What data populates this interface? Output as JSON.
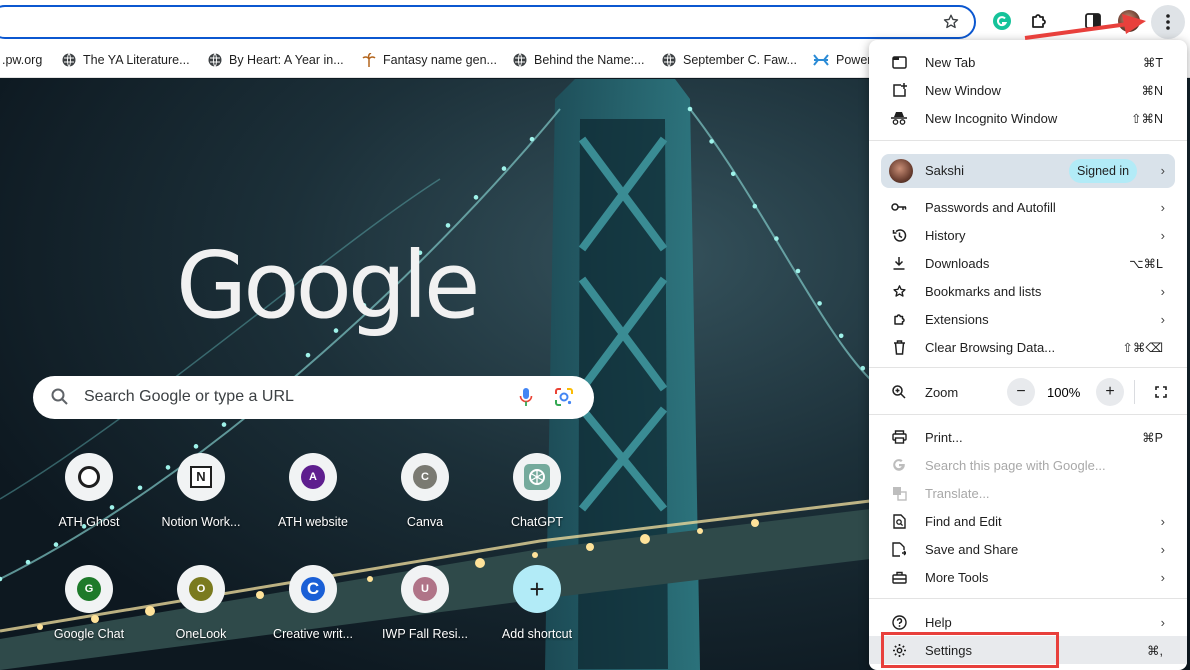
{
  "toolbar": {
    "star_icon": "star-icon",
    "icons": [
      "grammarly-icon",
      "extensions-puzzle-icon",
      "side-panel-icon",
      "profile-avatar-icon",
      "kebab-menu-icon"
    ]
  },
  "bookmarks": [
    {
      "label": ".pw.org",
      "icon": "none"
    },
    {
      "label": "The YA Literature...",
      "icon": "globe-icon"
    },
    {
      "label": "By Heart: A Year in...",
      "icon": "globe-icon"
    },
    {
      "label": "Fantasy name gen...",
      "icon": "palm-icon"
    },
    {
      "label": "Behind the Name:...",
      "icon": "globe-icon"
    },
    {
      "label": "September C. Faw...",
      "icon": "globe-icon"
    },
    {
      "label": "Power",
      "icon": "power-icon"
    }
  ],
  "ntp": {
    "logo": "Google",
    "search_placeholder": "Search Google or type a URL",
    "shortcuts": [
      {
        "label": "ATH Ghost",
        "letter": "",
        "color": "#1f1f1f"
      },
      {
        "label": "Notion Work...",
        "letter": "N",
        "color": "#1f1f1f"
      },
      {
        "label": "ATH website",
        "letter": "A",
        "color": "#5e1e8e"
      },
      {
        "label": "Canva",
        "letter": "C",
        "color": "#7a7a72"
      },
      {
        "label": "ChatGPT",
        "letter": "",
        "color": "#74aa9c"
      },
      {
        "label": "Google Chat",
        "letter": "G",
        "color": "#1e7a2a"
      },
      {
        "label": "OneLook",
        "letter": "O",
        "color": "#7a7a1e"
      },
      {
        "label": "Creative writ...",
        "letter": "C",
        "color": "#1a5fd6"
      },
      {
        "label": "IWP Fall Resi...",
        "letter": "U",
        "color": "#b07488"
      },
      {
        "label": "Add shortcut",
        "letter": "+",
        "color": "#b2ebf7"
      }
    ]
  },
  "menu": {
    "new_tab": {
      "label": "New Tab",
      "shortcut": "⌘T"
    },
    "new_window": {
      "label": "New Window",
      "shortcut": "⌘N"
    },
    "new_incognito": {
      "label": "New Incognito Window",
      "shortcut": "⇧⌘N"
    },
    "profile": {
      "name": "Sakshi",
      "status": "Signed in"
    },
    "passwords": {
      "label": "Passwords and Autofill"
    },
    "history": {
      "label": "History"
    },
    "downloads": {
      "label": "Downloads",
      "shortcut": "⌥⌘L"
    },
    "bookmarks": {
      "label": "Bookmarks and lists"
    },
    "extensions": {
      "label": "Extensions"
    },
    "clear_data": {
      "label": "Clear Browsing Data...",
      "shortcut": "⇧⌘⌫"
    },
    "zoom": {
      "label": "Zoom",
      "minus": "−",
      "value": "100%",
      "plus": "+"
    },
    "print": {
      "label": "Print...",
      "shortcut": "⌘P"
    },
    "search_page": {
      "label": "Search this page with Google..."
    },
    "translate": {
      "label": "Translate..."
    },
    "find_edit": {
      "label": "Find and Edit"
    },
    "save_share": {
      "label": "Save and Share"
    },
    "more_tools": {
      "label": "More Tools"
    },
    "help": {
      "label": "Help"
    },
    "settings": {
      "label": "Settings",
      "shortcut": "⌘,"
    }
  },
  "annotation": {
    "highlight_color": "#e8403c"
  }
}
